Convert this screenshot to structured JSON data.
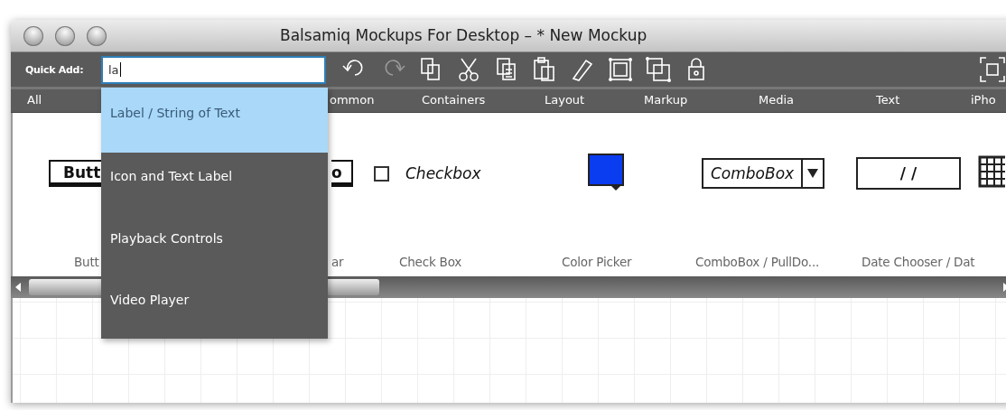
{
  "window": {
    "title": "Balsamiq Mockups For Desktop – * New Mockup"
  },
  "toolbar": {
    "quick_add_label": "Quick Add:",
    "quick_add_value": "la"
  },
  "categories": [
    {
      "label": "All"
    },
    {
      "label": "ommon"
    },
    {
      "label": "Containers"
    },
    {
      "label": "Layout"
    },
    {
      "label": "Markup"
    },
    {
      "label": "Media"
    },
    {
      "label": "Text"
    },
    {
      "label": "iPho"
    }
  ],
  "components": [
    {
      "kind": "button",
      "widget_text": "Butt",
      "label": "Butt"
    },
    {
      "kind": "buttonbar",
      "widget_text": "o",
      "label": "ar"
    },
    {
      "kind": "checkbox",
      "widget_text": "Checkbox",
      "label": "Check Box"
    },
    {
      "kind": "colorpicker",
      "label": "Color Picker"
    },
    {
      "kind": "combobox",
      "widget_text": "ComboBox",
      "label": "ComboBox / PullDo..."
    },
    {
      "kind": "datechooser",
      "widget_text": "/ /",
      "label": "Date Chooser / Dat"
    },
    {
      "kind": "calendar"
    }
  ],
  "dropdown": [
    {
      "label": "Label / String of Text",
      "selected": true
    },
    {
      "label": "Icon and Text Label",
      "selected": false
    },
    {
      "label": "Playback Controls",
      "selected": false
    },
    {
      "label": "Video Player",
      "selected": false
    }
  ]
}
